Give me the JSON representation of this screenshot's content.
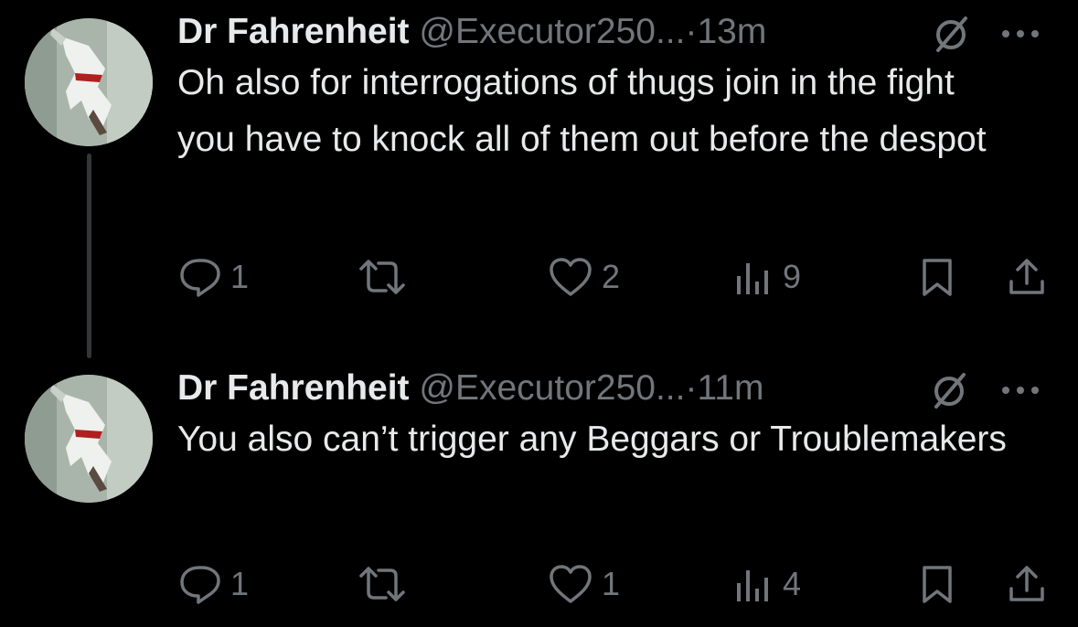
{
  "thread": {
    "tweets": [
      {
        "author": {
          "name": "Dr Fahrenheit",
          "handle": "@Executor250...",
          "avatar_icon": "avatar-image"
        },
        "dot": "·",
        "time": "13m",
        "text": "Oh also for interrogations of thugs join in the fight you have to knock all of them out before the despot",
        "actions": {
          "reply_count": "1",
          "retweet_count": "",
          "like_count": "2",
          "view_count": "9"
        }
      },
      {
        "author": {
          "name": "Dr Fahrenheit",
          "handle": "@Executor250...",
          "avatar_icon": "avatar-image"
        },
        "dot": "·",
        "time": "11m",
        "text": "You also can’t trigger any Beggars or Troublemakers",
        "actions": {
          "reply_count": "1",
          "retweet_count": "",
          "like_count": "1",
          "view_count": "4"
        }
      }
    ]
  },
  "icons": {
    "verified": "verified-slash-icon",
    "more": "more-dots-icon",
    "reply": "reply-icon",
    "retweet": "retweet-icon",
    "like": "heart-icon",
    "views": "views-icon",
    "bookmark": "bookmark-icon",
    "share": "share-icon"
  },
  "colors": {
    "background": "#000000",
    "text_primary": "#e7e9ea",
    "text_secondary": "#71767b",
    "thread_line": "#333639"
  }
}
